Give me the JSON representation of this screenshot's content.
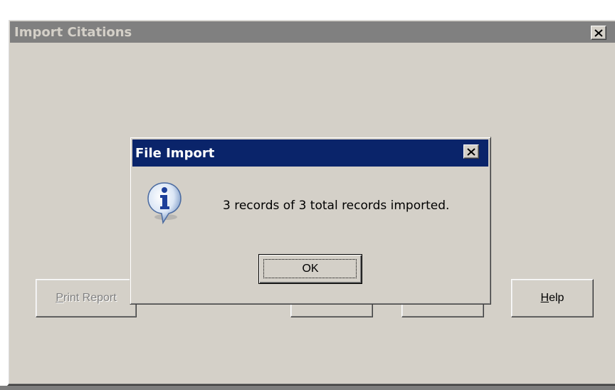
{
  "window": {
    "title": "Import Citations",
    "close_icon": "close-icon"
  },
  "buttons": {
    "print_report": {
      "accel": "P",
      "rest": "rint Report",
      "enabled": false
    },
    "help": {
      "accel": "H",
      "rest": "elp",
      "enabled": true
    }
  },
  "dialog": {
    "title": "File Import",
    "icon": "info-icon",
    "message": "3 records of 3 total records imported.",
    "ok_label": "OK"
  },
  "colors": {
    "dialog_titlebar": "#0a246a",
    "inactive_titlebar": "#808080",
    "face": "#d4d0c8"
  }
}
